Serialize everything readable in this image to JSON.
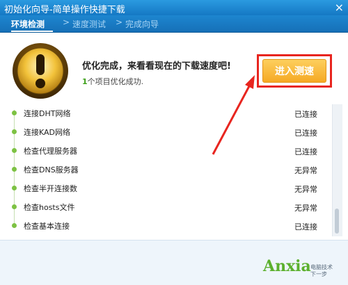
{
  "window": {
    "title": "初始化向导-简单操作快捷下载",
    "close_label": "×"
  },
  "steps": [
    {
      "label": "环境检测"
    },
    {
      "label": "速度测试"
    },
    {
      "label": "完成向导"
    }
  ],
  "step_separator": ">",
  "result": {
    "headline": "优化完成，来看看现在的下载速度吧!",
    "count": "1",
    "count_suffix": "个项目优化成功."
  },
  "test_button": {
    "label": "进入测速"
  },
  "checks": [
    {
      "label": "连接DHT网络",
      "status": "已连接"
    },
    {
      "label": "连接KAD网络",
      "status": "已连接"
    },
    {
      "label": "检查代理服务器",
      "status": "已连接"
    },
    {
      "label": "检查DNS服务器",
      "status": "无异常"
    },
    {
      "label": "检查半开连接数",
      "status": "无异常"
    },
    {
      "label": "检查hosts文件",
      "status": "无异常"
    },
    {
      "label": "检查基本连接",
      "status": "已连接"
    }
  ],
  "watermark": {
    "brand": "Anxia",
    "sub1": "电脑技术",
    "sub2": "下一步"
  },
  "colors": {
    "title_bar": "#1d86d0",
    "accent_green": "#3ea11a",
    "button_orange": "#f5a924",
    "highlight_red": "#e8251f"
  }
}
